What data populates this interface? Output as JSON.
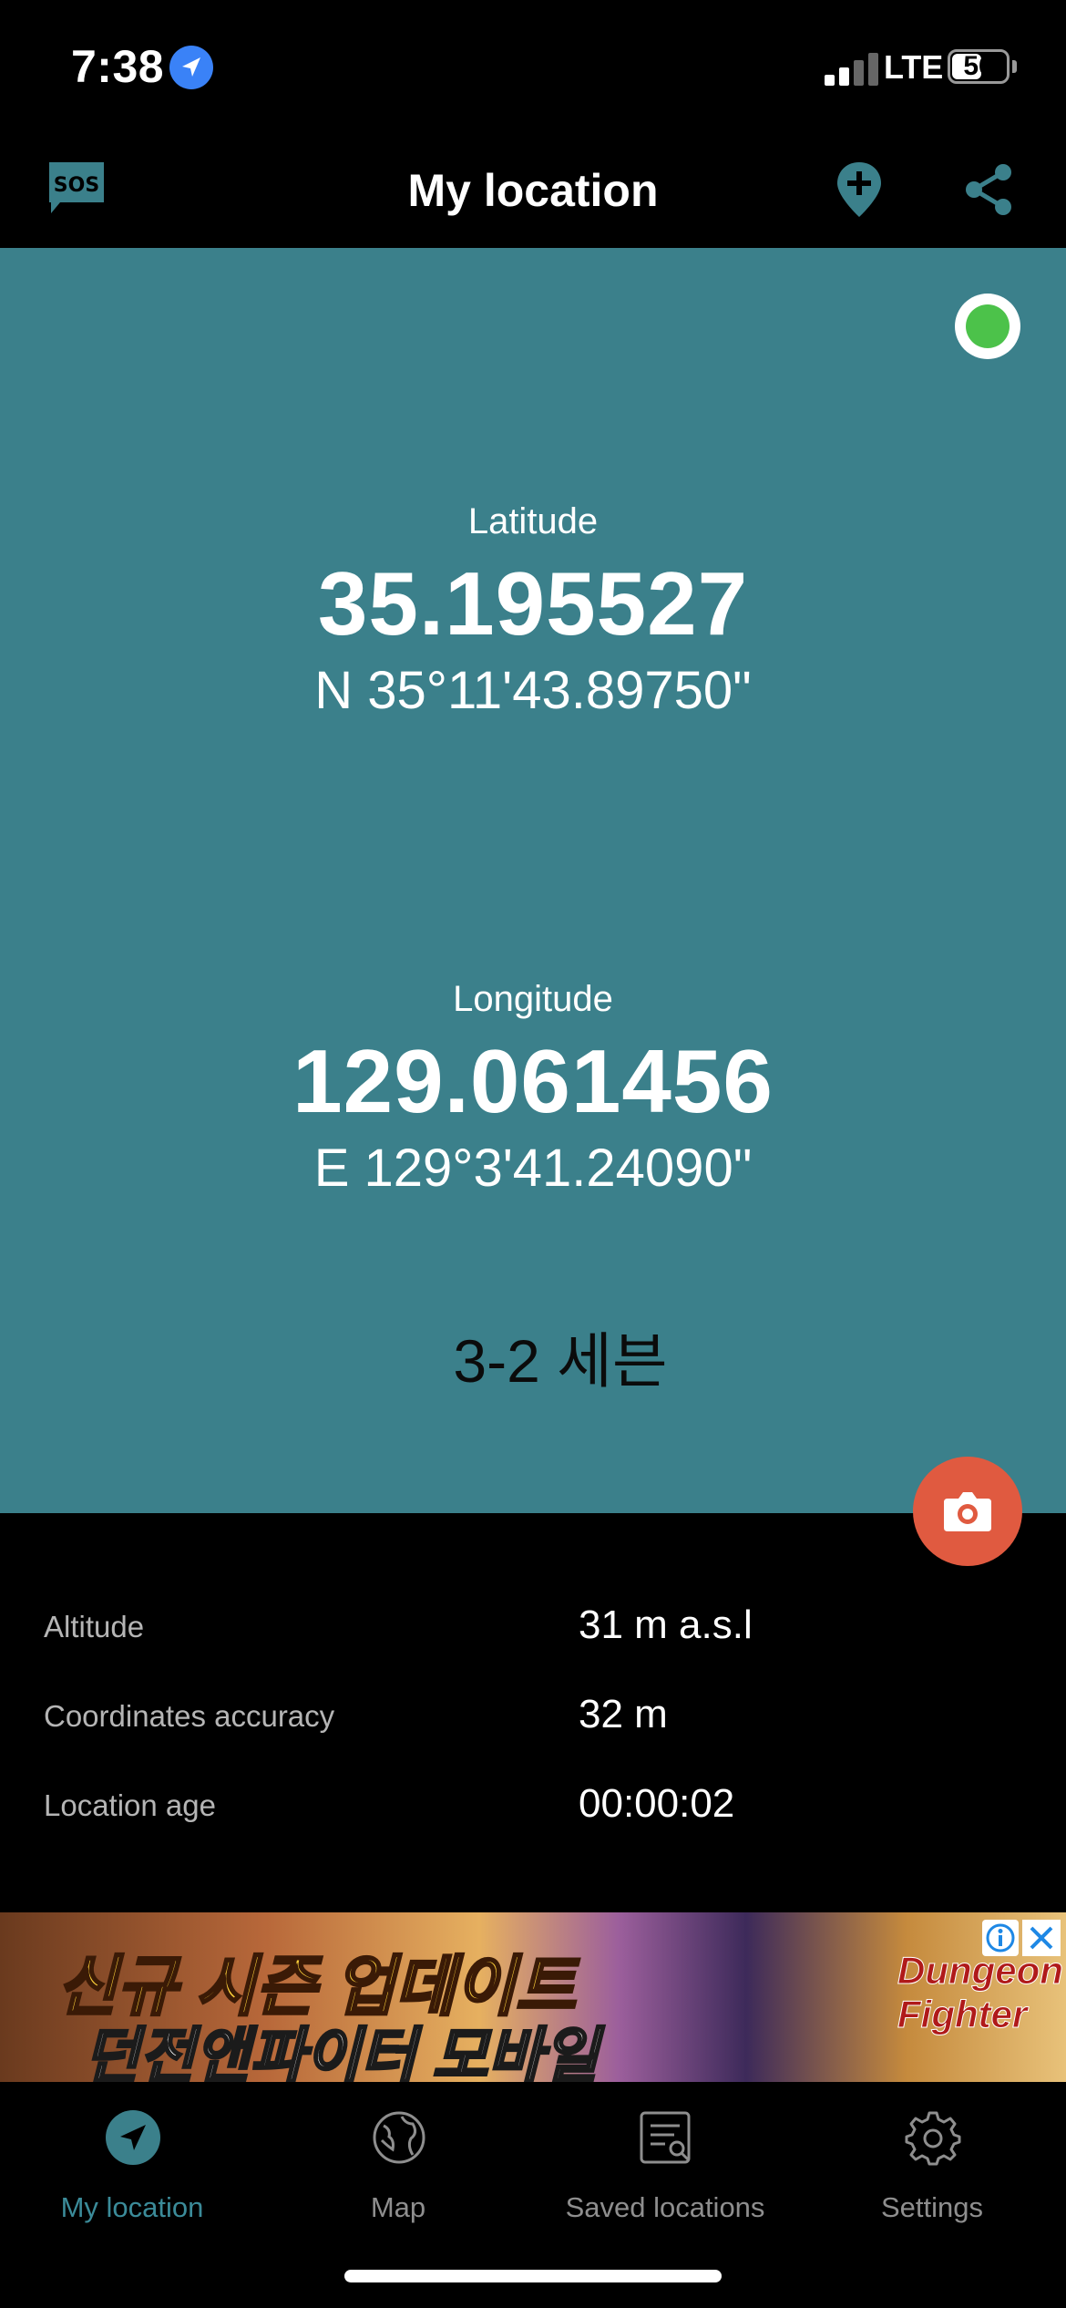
{
  "status_bar": {
    "time": "7:38",
    "network": "LTE",
    "battery": "56",
    "battery_level": 0.56
  },
  "header": {
    "title": "My location",
    "sos_label": "SOS"
  },
  "colors": {
    "panel": "#3b808b",
    "accent": "#3b8b99",
    "gps_ok": "#4cc24a",
    "camera": "#e05a40"
  },
  "coordinates": {
    "latitude_label": "Latitude",
    "latitude_value": "35.195527",
    "latitude_dms": "N 35°11'43.89750\"",
    "longitude_label": "Longitude",
    "longitude_value": "129.061456",
    "longitude_dms": "E 129°3'41.24090\"",
    "address": "3-2 세븐"
  },
  "details": [
    {
      "label": "Altitude",
      "value": "31 m a.s.l"
    },
    {
      "label": "Coordinates accuracy",
      "value": "32 m"
    },
    {
      "label": "Location age",
      "value": "00:00:02"
    }
  ],
  "ad": {
    "line1": "신규 시즌 업데이트",
    "line2": "던전앤파이터 모바일",
    "logo_text": "Dungeon Fighter"
  },
  "tabs": [
    {
      "label": "My location",
      "icon": "navigation-icon",
      "active": true
    },
    {
      "label": "Map",
      "icon": "globe-icon",
      "active": false
    },
    {
      "label": "Saved locations",
      "icon": "saved-list-icon",
      "active": false
    },
    {
      "label": "Settings",
      "icon": "gear-icon",
      "active": false
    }
  ]
}
